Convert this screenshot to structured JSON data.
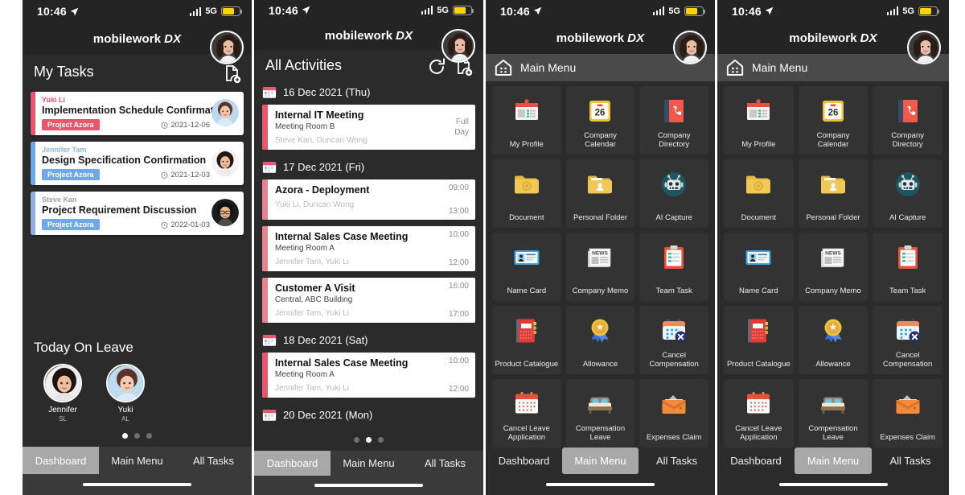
{
  "status_bar": {
    "time": "10:46",
    "network": "5G",
    "location_icon": "location-arrow-icon",
    "battery_level": 72
  },
  "app_header": {
    "brand_primary": "mobilework",
    "brand_secondary": "DX"
  },
  "colors": {
    "accent_red": "#e8556d",
    "accent_blue": "#6ea8e8",
    "badge_red": "#e8556d",
    "badge_blue": "#6ea8e8",
    "tab_active": "#a8a8a8",
    "battery_yellow": "#ffd400"
  },
  "panel1": {
    "section_title": "My Tasks",
    "add_doc_icon": "document-add-icon",
    "tasks": [
      {
        "owner": "Yuki Li",
        "title": "Implementation Schedule Confirmation",
        "project": "Project Azora",
        "date": "2021-12-06",
        "accent": "#e8556d",
        "owner_color": "#e8556d"
      },
      {
        "owner": "Jennifer Tam",
        "title": "Design Specification Confirmation",
        "project": "Project Azora",
        "date": "2021-12-03",
        "accent": "#6ea8e8",
        "owner_color": "#8fb8e0"
      },
      {
        "owner": "Steve Kan",
        "title": "Project Requirement Discussion",
        "project": "Project Azora",
        "date": "2022-01-03",
        "accent": "#8fb0d8",
        "owner_color": "#a0a0a0"
      }
    ],
    "leave_title": "Today On Leave",
    "leave": [
      {
        "name": "Jennifer",
        "sub": "SL"
      },
      {
        "name": "Yuki",
        "sub": "AL"
      }
    ],
    "dots": {
      "count": 3,
      "active": 0
    },
    "tabs": [
      {
        "label": "Dashboard",
        "active": true
      },
      {
        "label": "Main Menu",
        "active": false
      },
      {
        "label": "All Tasks",
        "active": false
      }
    ]
  },
  "panel2": {
    "section_title": "All Activities",
    "refresh_icon": "refresh-icon",
    "add_doc_icon": "document-add-icon",
    "days": [
      {
        "date": "16 Dec 2021 (Thu)",
        "activities": [
          {
            "title": "Internal IT Meeting",
            "place": "Meeting Room B",
            "people": "Steve Kan, Duncan Wong",
            "start": "Full",
            "end": "Day",
            "full_day": true
          }
        ]
      },
      {
        "date": "17 Dec 2021 (Fri)",
        "activities": [
          {
            "title": "Azora - Deployment",
            "place": "",
            "people": "Yuki Li, Duncan Wong",
            "start": "09:00",
            "end": "13:00",
            "full_day": false
          },
          {
            "title": "Internal Sales Case Meeting",
            "place": "Meeting Room A",
            "people": "Jennifer Tam, Yuki Li",
            "start": "10:00",
            "end": "12:00",
            "full_day": false
          },
          {
            "title": "Customer A Visit",
            "place": "Central, ABC Building",
            "people": "Jennifer Tam, Yuki Li",
            "start": "16:00",
            "end": "17:00",
            "full_day": false
          }
        ]
      },
      {
        "date": "18 Dec 2021 (Sat)",
        "activities": [
          {
            "title": "Internal Sales Case Meeting",
            "place": "Meeting Room A",
            "people": "Jennifer Tam, Yuki Li",
            "start": "10:00",
            "end": "12:00",
            "full_day": false
          }
        ]
      },
      {
        "date": "20 Dec 2021 (Mon)",
        "activities": []
      }
    ],
    "dots": {
      "count": 3,
      "active": 1
    },
    "tabs": [
      {
        "label": "Dashboard",
        "active": true
      },
      {
        "label": "Main Menu",
        "active": false
      },
      {
        "label": "All Tasks",
        "active": false
      }
    ]
  },
  "panel3": {
    "menu_bar": {
      "home_icon": "home-menu-icon",
      "label": "Main Menu"
    },
    "items": [
      {
        "label": "My Profile",
        "icon": "id-badge-icon"
      },
      {
        "label": "Company Calendar",
        "icon": "calendar-26-icon"
      },
      {
        "label": "Company Directory",
        "icon": "phone-book-icon"
      },
      {
        "label": "Document",
        "icon": "folder-document-icon"
      },
      {
        "label": "Personal Folder",
        "icon": "folder-person-icon"
      },
      {
        "label": "AI Capture",
        "icon": "robot-icon"
      },
      {
        "label": "Name Card",
        "icon": "name-card-icon"
      },
      {
        "label": "Company Memo",
        "icon": "news-icon"
      },
      {
        "label": "Team Task",
        "icon": "clipboard-checklist-icon"
      },
      {
        "label": "Product Catalogue",
        "icon": "red-notebook-icon"
      },
      {
        "label": "Allowance",
        "icon": "award-ribbon-icon"
      },
      {
        "label": "Cancel Compensation",
        "icon": "calendar-cancel-icon"
      },
      {
        "label": "Cancel Leave Application",
        "icon": "calendar-leave-icon"
      },
      {
        "label": "Compensation Leave",
        "icon": "bed-icon"
      },
      {
        "label": "Expenses Claim",
        "icon": "expenses-wallet-icon"
      }
    ],
    "tabs": [
      {
        "label": "Dashboard",
        "active": false
      },
      {
        "label": "Main Menu",
        "active": true
      },
      {
        "label": "All Tasks",
        "active": false
      }
    ]
  },
  "panel4": {
    "menu_bar": {
      "home_icon": "home-menu-icon",
      "label": "Main Menu"
    },
    "items": [
      {
        "label": "My Profile",
        "icon": "id-badge-icon"
      },
      {
        "label": "Company Calendar",
        "icon": "calendar-26-icon"
      },
      {
        "label": "Company Directory",
        "icon": "phone-book-icon"
      },
      {
        "label": "Document",
        "icon": "folder-document-icon"
      },
      {
        "label": "Personal Folder",
        "icon": "folder-person-icon"
      },
      {
        "label": "AI Capture",
        "icon": "robot-icon"
      },
      {
        "label": "Name Card",
        "icon": "name-card-icon"
      },
      {
        "label": "Company Memo",
        "icon": "news-icon"
      },
      {
        "label": "Team Task",
        "icon": "clipboard-checklist-icon"
      },
      {
        "label": "Product Catalogue",
        "icon": "red-notebook-icon"
      },
      {
        "label": "Allowance",
        "icon": "award-ribbon-icon"
      },
      {
        "label": "Cancel Compensation",
        "icon": "calendar-cancel-icon"
      },
      {
        "label": "Cancel Leave Application",
        "icon": "calendar-leave-icon"
      },
      {
        "label": "Compensation Leave",
        "icon": "bed-icon"
      },
      {
        "label": "Expenses Claim",
        "icon": "expenses-wallet-icon"
      }
    ],
    "tabs": [
      {
        "label": "Dashboard",
        "active": false
      },
      {
        "label": "Main Menu",
        "active": true
      },
      {
        "label": "All Tasks",
        "active": false
      }
    ]
  }
}
